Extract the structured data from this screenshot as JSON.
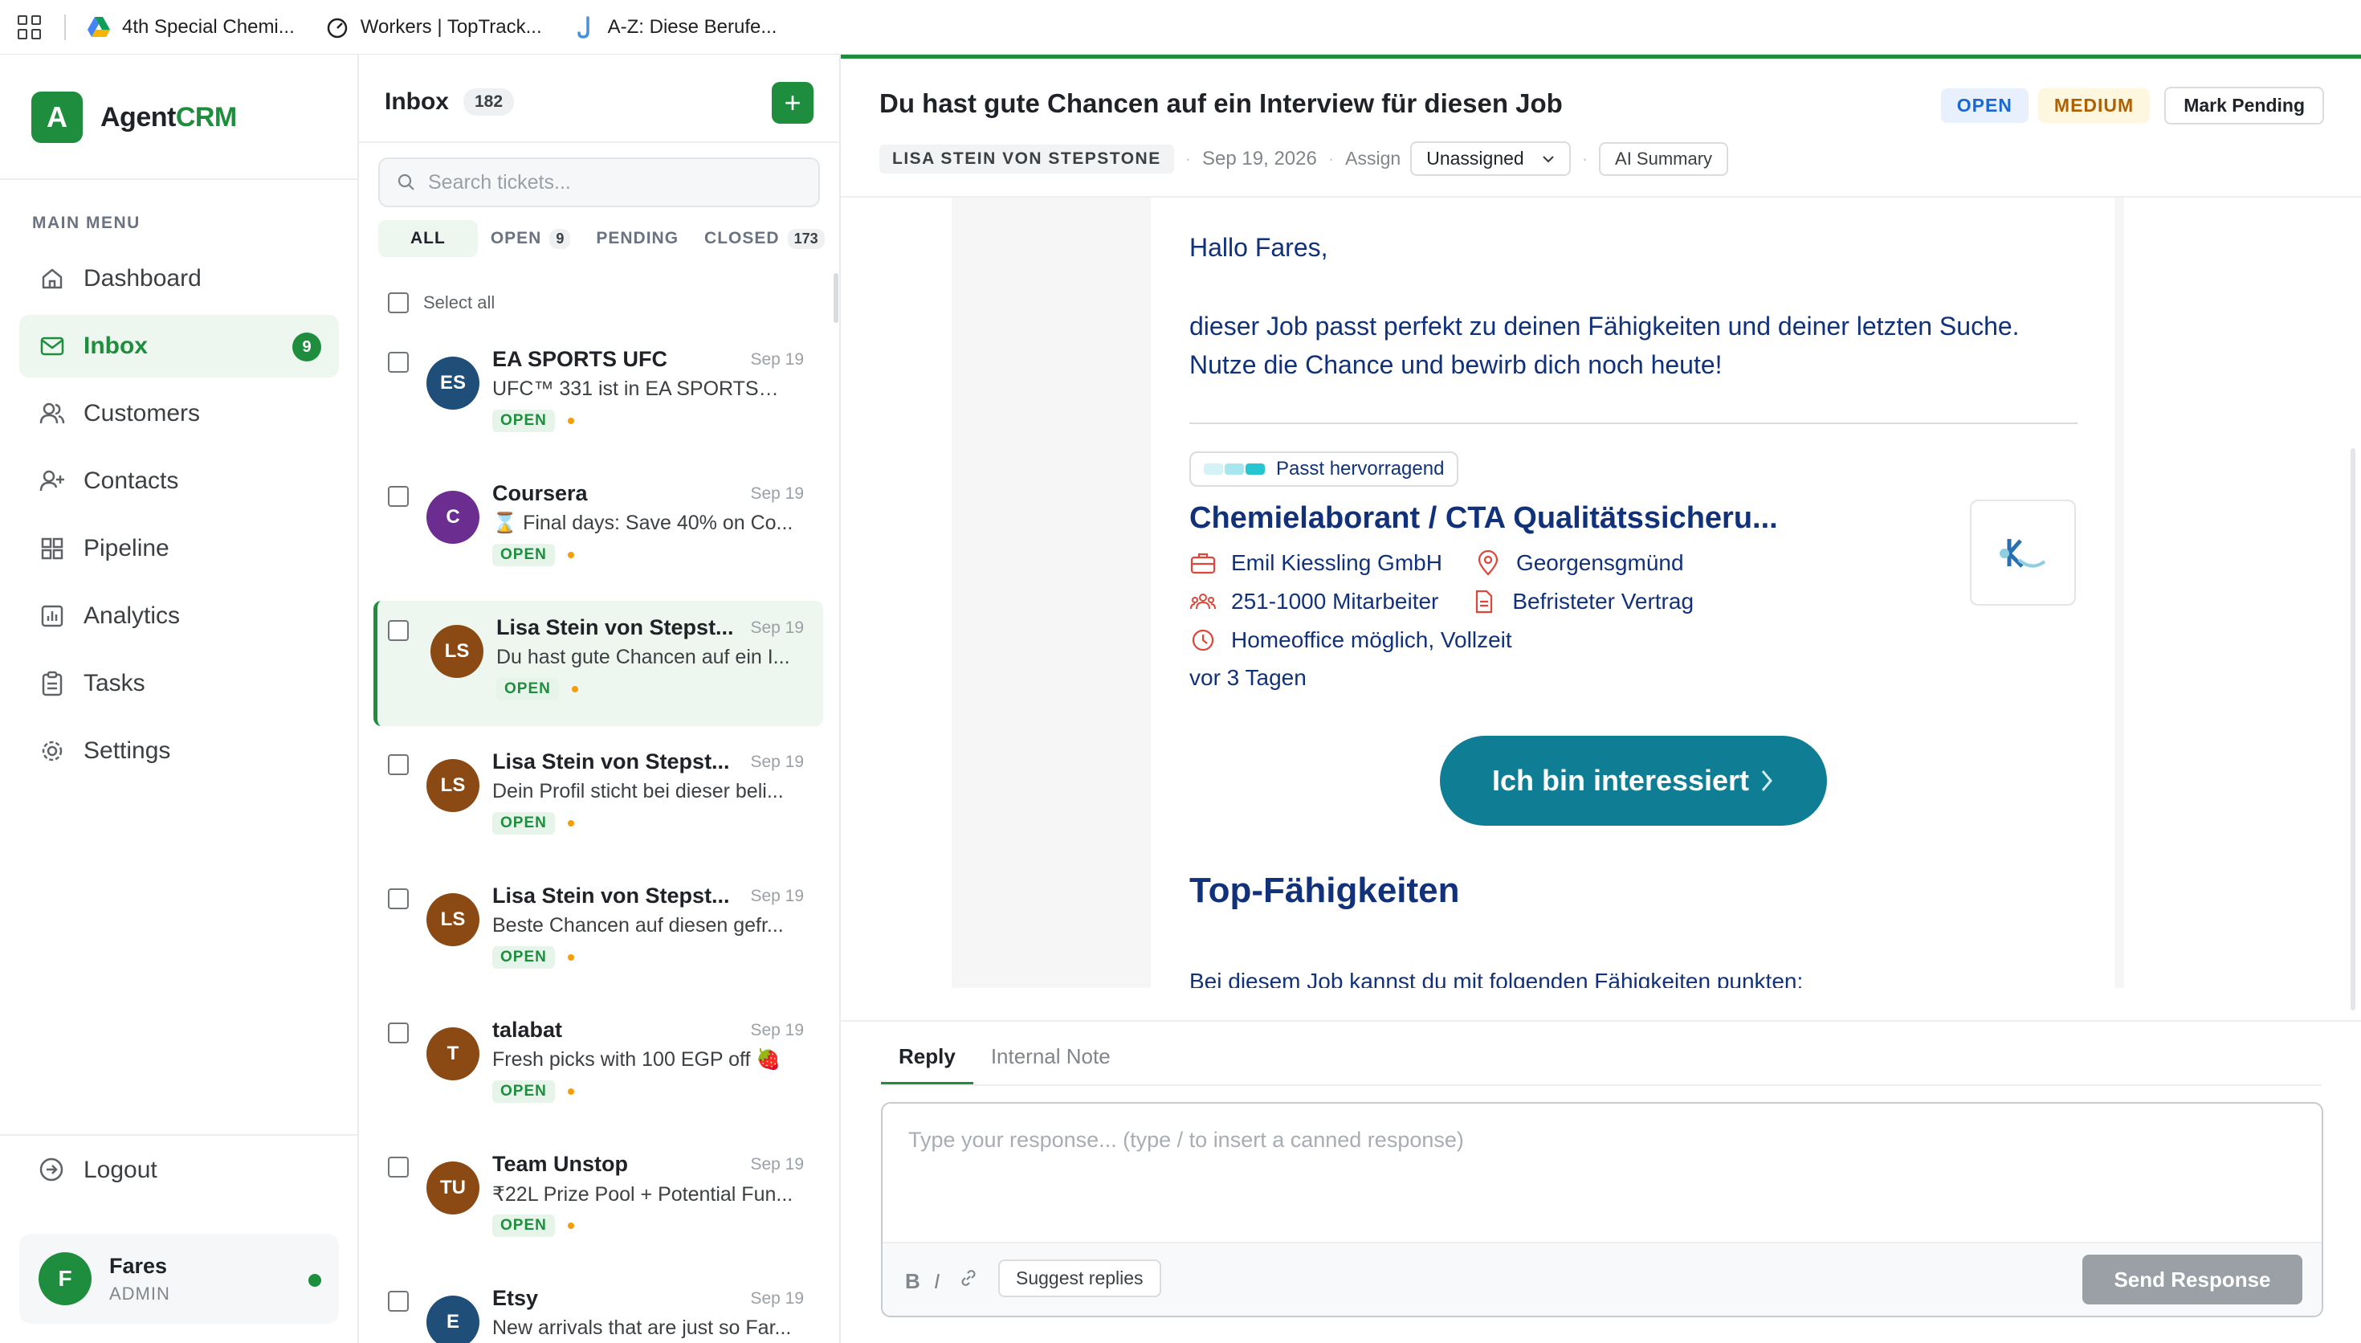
{
  "bookmarks": [
    {
      "label": "4th Special Chemi...",
      "icon": "google-drive-icon"
    },
    {
      "label": "Workers | TopTrack...",
      "icon": "timer-icon"
    },
    {
      "label": "A-Z: Diese Berufe...",
      "icon": "j-logo-icon"
    }
  ],
  "brand": {
    "logo_letter": "A",
    "name_part1": "Agent",
    "name_part2": "CRM"
  },
  "sidebar": {
    "heading": "MAIN MENU",
    "items": [
      {
        "label": "Dashboard",
        "icon": "home-icon"
      },
      {
        "label": "Inbox",
        "icon": "mail-icon",
        "badge": "9"
      },
      {
        "label": "Customers",
        "icon": "users-icon"
      },
      {
        "label": "Contacts",
        "icon": "user-plus-icon"
      },
      {
        "label": "Pipeline",
        "icon": "grid-icon"
      },
      {
        "label": "Analytics",
        "icon": "bar-chart-icon"
      },
      {
        "label": "Tasks",
        "icon": "clipboard-icon"
      },
      {
        "label": "Settings",
        "icon": "gear-icon"
      }
    ],
    "logout": "Logout",
    "user": {
      "initial": "F",
      "name": "Fares",
      "role": "ADMIN"
    }
  },
  "inbox": {
    "title": "Inbox",
    "count": "182",
    "add_label": "+",
    "search_placeholder": "Search tickets...",
    "filters": [
      {
        "label": "ALL",
        "count": ""
      },
      {
        "label": "OPEN",
        "count": "9"
      },
      {
        "label": "PENDING",
        "count": ""
      },
      {
        "label": "CLOSED",
        "count": "173"
      }
    ],
    "select_all": "Select all",
    "tickets": [
      {
        "initials": "ES",
        "from": "EA SPORTS UFC",
        "date": "Sep 19",
        "subject": "UFC™ 331 ist in EA SPORTS™ U...",
        "status": "OPEN",
        "avatar_color": "#1f4e79"
      },
      {
        "initials": "C",
        "from": "Coursera",
        "date": "Sep 19",
        "subject": "⌛ Final days: Save 40% on Co...",
        "status": "OPEN",
        "avatar_color": "#6b2d8f"
      },
      {
        "initials": "LS",
        "from": "Lisa Stein von Stepst...",
        "date": "Sep 19",
        "subject": "Du hast gute Chancen auf ein I...",
        "status": "OPEN",
        "avatar_color": "#8b4a14"
      },
      {
        "initials": "LS",
        "from": "Lisa Stein von Stepst...",
        "date": "Sep 19",
        "subject": "Dein Profil sticht bei dieser beli...",
        "status": "OPEN",
        "avatar_color": "#8b4a14"
      },
      {
        "initials": "LS",
        "from": "Lisa Stein von Stepst...",
        "date": "Sep 19",
        "subject": "Beste Chancen auf diesen gefr...",
        "status": "OPEN",
        "avatar_color": "#8b4a14"
      },
      {
        "initials": "T",
        "from": "talabat",
        "date": "Sep 19",
        "subject": "Fresh picks with 100 EGP off 🍓",
        "status": "OPEN",
        "avatar_color": "#8b4a14"
      },
      {
        "initials": "TU",
        "from": "Team Unstop",
        "date": "Sep 19",
        "subject": "₹22L Prize Pool + Potential Fun...",
        "status": "OPEN",
        "avatar_color": "#8b4a14"
      },
      {
        "initials": "E",
        "from": "Etsy",
        "date": "Sep 19",
        "subject": "New arrivals that are just so Far...",
        "status": "OPEN",
        "avatar_color": "#1f4e79"
      }
    ]
  },
  "detail": {
    "title": "Du hast gute Chancen auf ein Interview für diesen Job",
    "status": "OPEN",
    "priority": "MEDIUM",
    "mark_pending": "Mark Pending",
    "sender": "LISA STEIN VON STEPSTONE",
    "date": "Sep 19, 2026",
    "assign_label": "Assign",
    "assign_value": "Unassigned",
    "ai_summary": "AI Summary"
  },
  "email": {
    "greeting": "Hallo Fares,",
    "body_line1": "dieser Job passt perfekt zu deinen Fähigkeiten und deiner letzten Suche.",
    "body_line2": "Nutze die Chance und bewirb dich noch heute!",
    "match_label": "Passt hervorragend",
    "job_title": "Chemielaborant / CTA Qualitätssicheru...",
    "company": "Emil Kiessling GmbH",
    "location": "Georgensgmünd",
    "employees": "251-1000 Mitarbeiter",
    "contract": "Befristeter Vertrag",
    "work_mode": "Homeoffice möglich, Vollzeit",
    "posted": "vor 3 Tagen",
    "cta": "Ich bin interessiert",
    "skills_title": "Top-Fähigkeiten",
    "skills_sub": "Bei diesem Job kannst du mit folgenden Fähigkeiten punkten:"
  },
  "reply": {
    "tab_reply": "Reply",
    "tab_note": "Internal Note",
    "placeholder": "Type your response... (type / to insert a canned response)",
    "bold": "B",
    "italic": "I",
    "suggest": "Suggest replies",
    "send": "Send Response"
  },
  "colors": {
    "accent": "#1e8e3e",
    "email_text": "#11327a",
    "cta": "#0f7d94"
  }
}
